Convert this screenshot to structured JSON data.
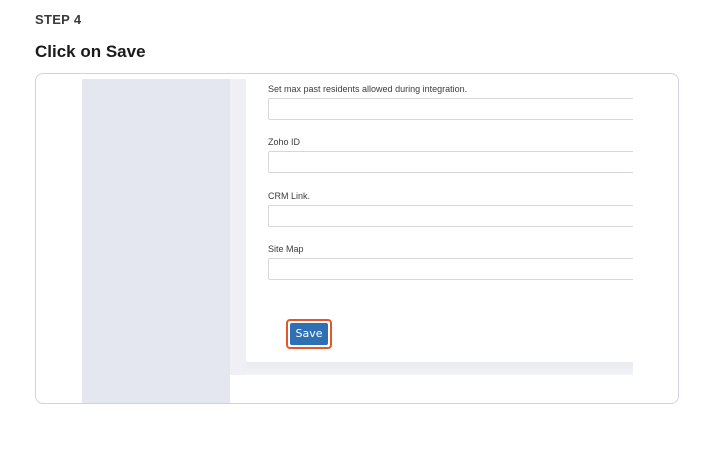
{
  "step": {
    "label": "STEP 4",
    "title": "Click on Save"
  },
  "form": {
    "fields": [
      {
        "label": "Set max past residents allowed during integration.",
        "value": ""
      },
      {
        "label": "Zoho ID",
        "value": ""
      },
      {
        "label": "CRM Link.",
        "value": ""
      },
      {
        "label": "Site Map",
        "value": ""
      }
    ],
    "save_label": "Save"
  },
  "colors": {
    "save_button": "#2f6fb3",
    "highlight_ring": "#e4572e",
    "sidebar": "#e4e7f0"
  }
}
